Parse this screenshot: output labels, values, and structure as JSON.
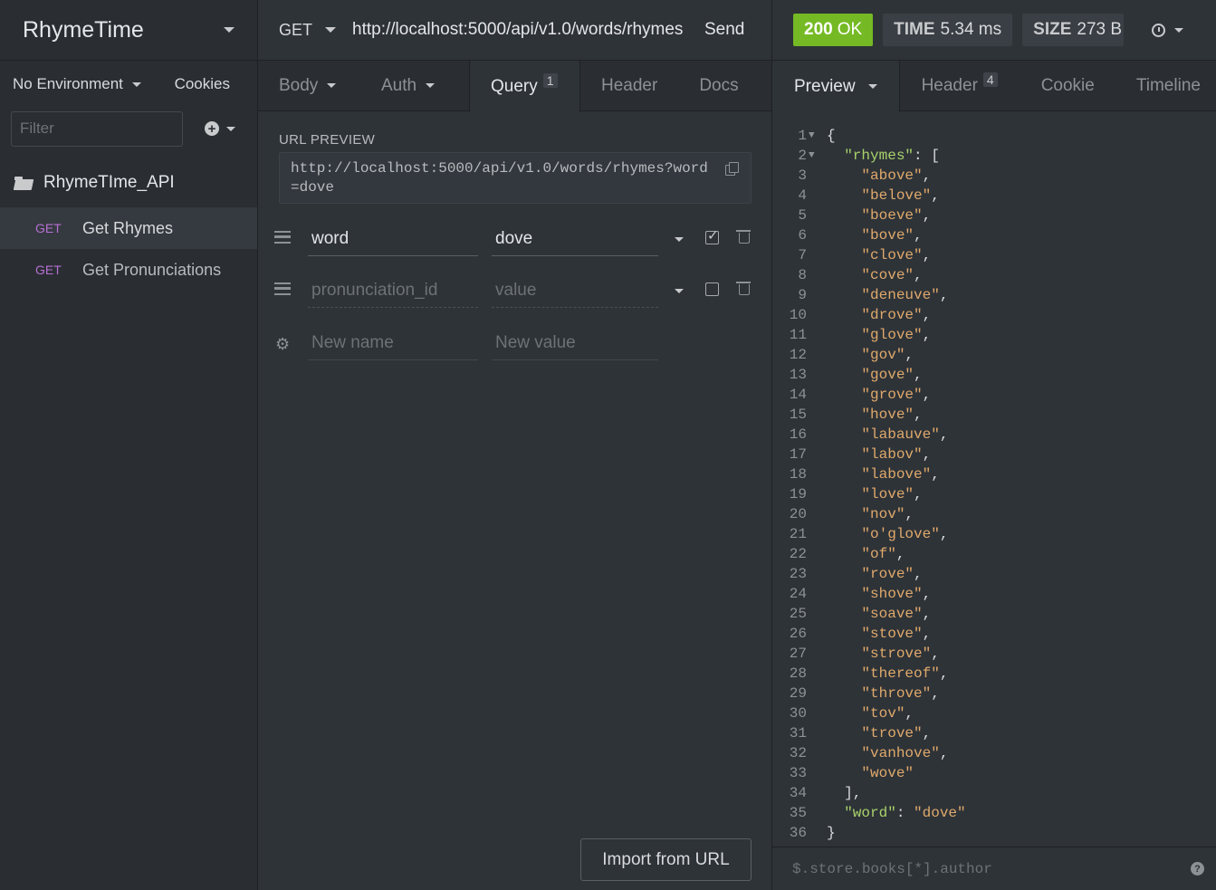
{
  "sidebar": {
    "title": "RhymeTime",
    "environment": "No Environment",
    "cookies": "Cookies",
    "filter_placeholder": "Filter",
    "folder": "RhymeTIme_API",
    "requests": [
      {
        "method": "GET",
        "name": "Get Rhymes"
      },
      {
        "method": "GET",
        "name": "Get Pronunciations"
      }
    ]
  },
  "request": {
    "method": "GET",
    "url": "http://localhost:5000/api/v1.0/words/rhymes",
    "send": "Send",
    "tabs": {
      "body": "Body",
      "auth": "Auth",
      "query": "Query",
      "query_count": "1",
      "header": "Header",
      "docs": "Docs"
    },
    "url_preview_label": "URL PREVIEW",
    "url_preview": "http://localhost:5000/api/v1.0/words/rhymes?word=dove",
    "params": [
      {
        "name": "word",
        "value": "dove",
        "enabled": true
      },
      {
        "name_placeholder": "pronunciation_id",
        "value_placeholder": "value",
        "enabled": false
      }
    ],
    "new_name_placeholder": "New name",
    "new_value_placeholder": "New value",
    "import_button": "Import from URL"
  },
  "response": {
    "status_code": "200",
    "status_text": "OK",
    "time_label": "TIME",
    "time_value": "5.34 ms",
    "size_label": "SIZE",
    "size_value": "273 B",
    "tabs": {
      "preview": "Preview",
      "header": "Header",
      "header_count": "4",
      "cookie": "Cookie",
      "timeline": "Timeline"
    },
    "rhymes_key": "rhymes",
    "rhymes": [
      "above",
      "belove",
      "boeve",
      "bove",
      "clove",
      "cove",
      "deneuve",
      "drove",
      "glove",
      "gov",
      "gove",
      "grove",
      "hove",
      "labauve",
      "labov",
      "labove",
      "love",
      "nov",
      "o'glove",
      "of",
      "rove",
      "shove",
      "soave",
      "stove",
      "strove",
      "thereof",
      "throve",
      "tov",
      "trove",
      "vanhove",
      "wove"
    ],
    "word_key": "word",
    "word_value": "dove",
    "filter_placeholder": "$.store.books[*].author"
  }
}
